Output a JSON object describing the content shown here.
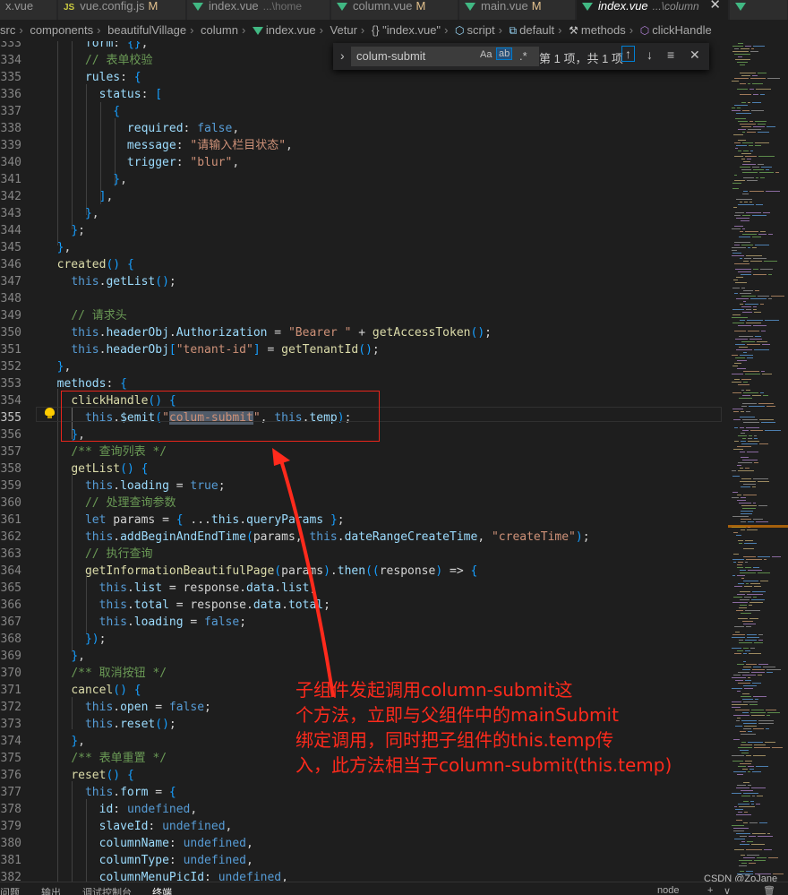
{
  "tabs": [
    {
      "label": "x.vue",
      "path": "",
      "modified": "",
      "icon": "vue-icon"
    },
    {
      "label": "vue.config.js",
      "path": "",
      "modified": "M",
      "icon": "js-icon"
    },
    {
      "label": "index.vue",
      "path": "...\\home",
      "modified": "",
      "icon": "vue-icon"
    },
    {
      "label": "column.vue",
      "path": "",
      "modified": "M",
      "icon": "vue-icon"
    },
    {
      "label": "main.vue",
      "path": "",
      "modified": "M",
      "icon": "vue-icon"
    },
    {
      "label": "index.vue",
      "path": "...\\column",
      "modified": "",
      "icon": "vue-icon",
      "active": true
    }
  ],
  "breadcrumb": [
    "src",
    "components",
    "beautifulVillage",
    "column",
    "index.vue",
    "Vetur",
    "{} \"index.vue\"",
    "script",
    "default",
    "methods",
    "clickHandle"
  ],
  "find": {
    "query": "colum-submit",
    "opt_case": "Aa",
    "opt_word": "ab",
    "opt_regex": ".*",
    "result": "第 1 项，共 1 项",
    "up": "↑",
    "down": "↓",
    "menu": "≡",
    "close": "✕"
  },
  "editor": {
    "current_line": "355",
    "lines": [
      {
        "n": "333",
        "code": "      form: {},"
      },
      {
        "n": "334",
        "code": "      // 表单校验"
      },
      {
        "n": "335",
        "code": "      rules: {"
      },
      {
        "n": "336",
        "code": "        status: ["
      },
      {
        "n": "337",
        "code": "          {"
      },
      {
        "n": "338",
        "code": "            required: false,"
      },
      {
        "n": "339",
        "code": "            message: \"请输入栏目状态\","
      },
      {
        "n": "340",
        "code": "            trigger: \"blur\","
      },
      {
        "n": "341",
        "code": "          },"
      },
      {
        "n": "342",
        "code": "        ],"
      },
      {
        "n": "343",
        "code": "      },"
      },
      {
        "n": "344",
        "code": "    };"
      },
      {
        "n": "345",
        "code": "  },"
      },
      {
        "n": "346",
        "code": "  created() {"
      },
      {
        "n": "347",
        "code": "    this.getList();"
      },
      {
        "n": "348",
        "code": ""
      },
      {
        "n": "349",
        "code": "    // 请求头"
      },
      {
        "n": "350",
        "code": "    this.headerObj.Authorization = \"Bearer \" + getAccessToken();"
      },
      {
        "n": "351",
        "code": "    this.headerObj[\"tenant-id\"] = getTenantId();"
      },
      {
        "n": "352",
        "code": "  },"
      },
      {
        "n": "353",
        "code": "  methods: {"
      },
      {
        "n": "354",
        "code": "    clickHandle() {"
      },
      {
        "n": "355",
        "code": "      this.$emit(\"colum-submit\", this.temp);"
      },
      {
        "n": "356",
        "code": "    },"
      },
      {
        "n": "357",
        "code": "    /** 查询列表 */"
      },
      {
        "n": "358",
        "code": "    getList() {"
      },
      {
        "n": "359",
        "code": "      this.loading = true;"
      },
      {
        "n": "360",
        "code": "      // 处理查询参数"
      },
      {
        "n": "361",
        "code": "      let params = { ...this.queryParams };"
      },
      {
        "n": "362",
        "code": "      this.addBeginAndEndTime(params, this.dateRangeCreateTime, \"createTime\");"
      },
      {
        "n": "363",
        "code": "      // 执行查询"
      },
      {
        "n": "364",
        "code": "      getInformationBeautifulPage(params).then((response) => {"
      },
      {
        "n": "365",
        "code": "        this.list = response.data.list;"
      },
      {
        "n": "366",
        "code": "        this.total = response.data.total;"
      },
      {
        "n": "367",
        "code": "        this.loading = false;"
      },
      {
        "n": "368",
        "code": "      });"
      },
      {
        "n": "369",
        "code": "    },"
      },
      {
        "n": "370",
        "code": "    /** 取消按钮 */"
      },
      {
        "n": "371",
        "code": "    cancel() {"
      },
      {
        "n": "372",
        "code": "      this.open = false;"
      },
      {
        "n": "373",
        "code": "      this.reset();"
      },
      {
        "n": "374",
        "code": "    },"
      },
      {
        "n": "375",
        "code": "    /** 表单重置 */"
      },
      {
        "n": "376",
        "code": "    reset() {"
      },
      {
        "n": "377",
        "code": "      this.form = {"
      },
      {
        "n": "378",
        "code": "        id: undefined,"
      },
      {
        "n": "379",
        "code": "        slaveId: undefined,"
      },
      {
        "n": "380",
        "code": "        columnName: undefined,"
      },
      {
        "n": "381",
        "code": "        columnType: undefined,"
      },
      {
        "n": "382",
        "code": "        columnMenuPicId: undefined,"
      }
    ]
  },
  "annotation": {
    "lines": [
      "子组件发起调用column-submit这",
      "个方法，立即与父组件中的mainSubmit",
      "绑定调用，同时把子组件的this.temp传",
      "入，此方法相当于column-submit(this.temp)"
    ],
    "color": "#ff2a1c"
  },
  "panel": {
    "tabs": [
      "问题",
      "输出",
      "调试控制台",
      "终端"
    ],
    "active": "终端",
    "terminal": "node",
    "add": "+",
    "chevron": "∨",
    "trash": "🗑"
  },
  "watermark": "CSDN @ZoJane"
}
